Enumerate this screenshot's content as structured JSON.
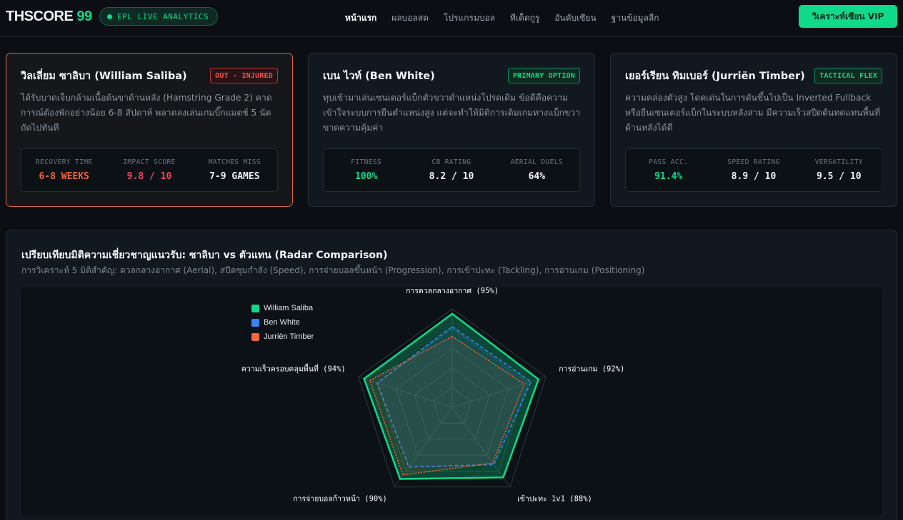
{
  "header": {
    "brand": "THSCORE",
    "brand_num": "99",
    "live_label": "EPL LIVE ANALYTICS",
    "nav": [
      {
        "label": "หน้าแรก",
        "active": true
      },
      {
        "label": "ผลบอลสด",
        "active": false
      },
      {
        "label": "โปรแกรมบอล",
        "active": false
      },
      {
        "label": "ทีเด็ดกูรู",
        "active": false
      },
      {
        "label": "อันดับเซียน",
        "active": false
      },
      {
        "label": "ฐานข้อมูลลีก",
        "active": false
      }
    ],
    "vip_button": "วิเคราะห์เซียน VIP"
  },
  "cards": [
    {
      "title": "วิลเลี่ยม ซาลิบา (William Saliba)",
      "badge": "OUT - INJURED",
      "badge_color": "#f05252",
      "description": "ได้รับบาดเจ็บกล้ามเนื้อต้นขาด้านหลัง (Hamstring Grade 2) คาดการณ์ต้องพักอย่างน้อย 6-8 สัปดาห์ พลาดลงเล่นเกมบิ๊กแมตช์ 5 นัดถัดไปทันที",
      "stats": [
        {
          "label": "RECOVERY TIME",
          "value": "6-8 WEEKS",
          "color": "#f3643f"
        },
        {
          "label": "IMPACT SCORE",
          "value": "9.8 / 10",
          "color": "#f4455f"
        },
        {
          "label": "MATCHES MISS",
          "value": "7-9 GAMES",
          "color": "#f3f4f6"
        }
      ]
    },
    {
      "title": "เบน ไวท์ (Ben White)",
      "badge": "PRIMARY OPTION",
      "badge_color": "#10d98a",
      "description": "ทุบเข้ามาเล่นเซนเตอร์แบ็กตัวขวาตำแหน่งโปรดเดิม ข้อดีคือความเข้าใจระบบการยืนตำแหน่งสูง แต่จะทำให้มิติการเติมเกมทางแบ็กขวาขาดความคุ้มค่า",
      "stats": [
        {
          "label": "FITNESS",
          "value": "100%",
          "color": "#10d98a"
        },
        {
          "label": "CB RATING",
          "value": "8.2 / 10",
          "color": "#f3f4f6"
        },
        {
          "label": "AERIAL DUELS",
          "value": "64%",
          "color": "#f3f4f6"
        }
      ]
    },
    {
      "title": "เยอร์เรียน ทิมเบอร์ (Jurriën Timber)",
      "badge": "TACTICAL FLEX",
      "badge_color": "#10d98a",
      "description": "ความคล่องตัวสูง โดดเด่นในการดันขึ้นไปเป็น Inverted Fullback หรือยืนเซนเตอร์แบ็กในระบบหลังสาม มีความเร็วสปีดต้นทดแทนพื้นที่ด้านหลังได้ดี",
      "stats": [
        {
          "label": "PASS ACC.",
          "value": "91.4%",
          "color": "#10d98a"
        },
        {
          "label": "SPEED RATING",
          "value": "8.9 / 10",
          "color": "#f3f4f6"
        },
        {
          "label": "VERSATILITY",
          "value": "9.5 / 10",
          "color": "#f3f4f6"
        }
      ]
    }
  ],
  "radar_panel": {
    "title": "เปรียบเทียบมิติความเชี่ยวชาญแนวรับ: ซาลิบา vs ตัวแทน (Radar Comparison)",
    "subtitle": "การวิเคราะห์ 5 มิติสำคัญ: ดวลกลางอากาศ (Aerial), สปีดชุมกำลัง (Speed), การจ่ายบอลขึ้นหน้า (Progression), การเข้าปะทะ (Tackling), การอ่านเกม (Positioning)"
  },
  "chart_data": {
    "type": "radar",
    "axes": [
      "การดวลกลางอากาศ (95%)",
      "การอ่านเกม (92%)",
      "เข้าปะทะ 1v1 (88%)",
      "การจ่ายบอลก้าวหน้า (90%)",
      "ความเร็วครอบคลุมพื้นที่ (94%)"
    ],
    "range": [
      0,
      100
    ],
    "series": [
      {
        "name": "William Saliba",
        "values": [
          95,
          92,
          88,
          90,
          94
        ],
        "color": "#10d98a",
        "style": "solid"
      },
      {
        "name": "Ben White",
        "values": [
          82,
          84,
          72,
          75,
          80
        ],
        "color": "#3b82f6",
        "style": "dashed"
      },
      {
        "name": "Jurriën Timber",
        "values": [
          72,
          77,
          70,
          85,
          88
        ],
        "color": "#f3643f",
        "style": "dotted"
      }
    ]
  }
}
